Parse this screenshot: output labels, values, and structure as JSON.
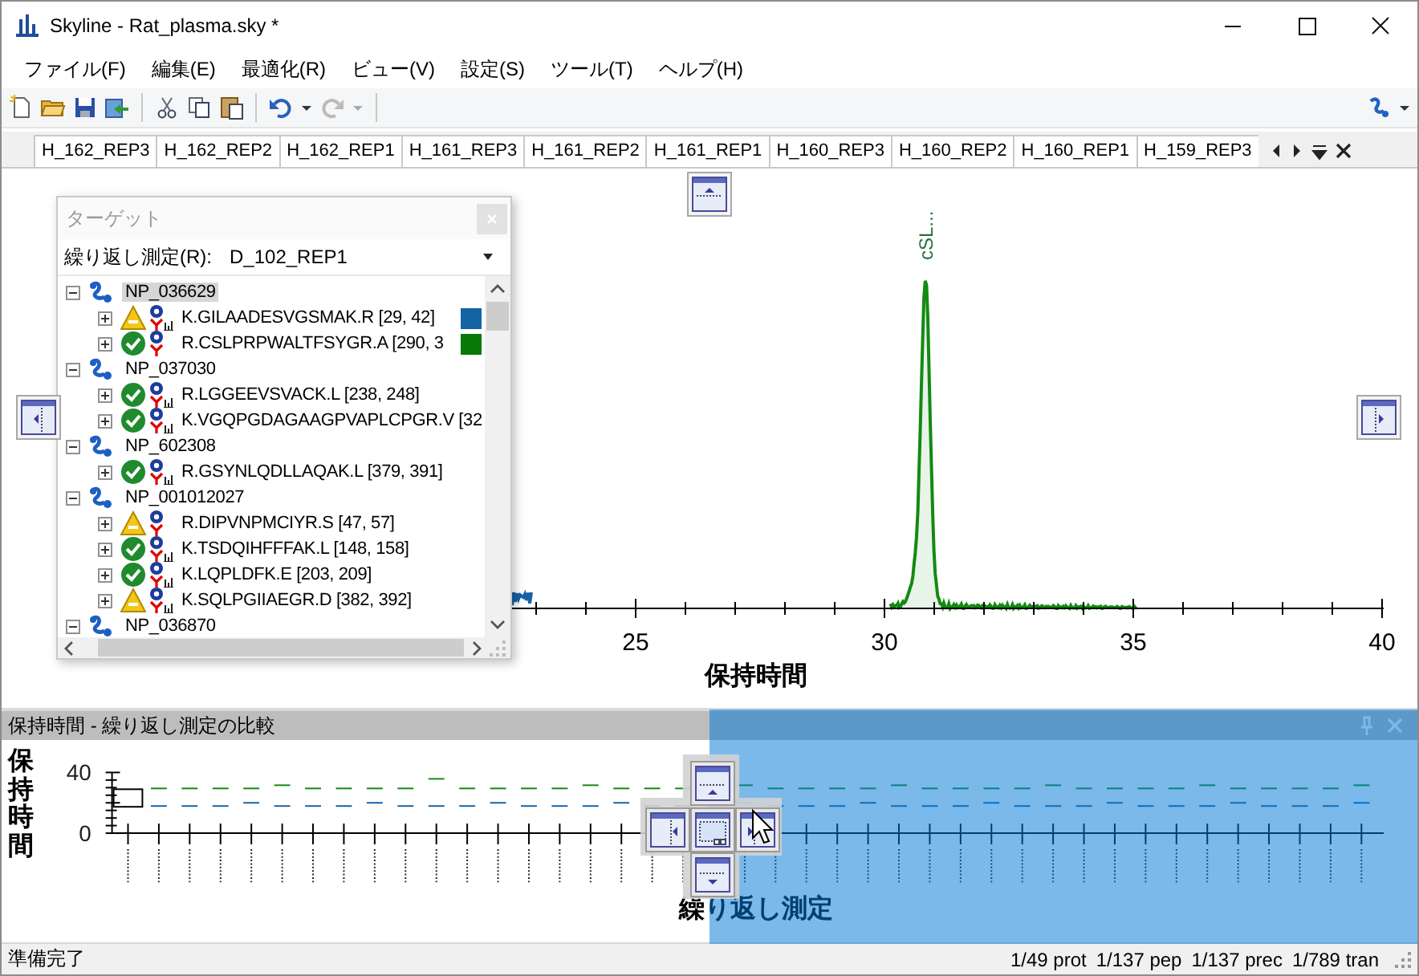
{
  "window": {
    "title": "Skyline - Rat_plasma.sky *"
  },
  "menu": [
    "ファイル(F)",
    "編集(E)",
    "最適化(R)",
    "ビュー(V)",
    "設定(S)",
    "ツール(T)",
    "ヘルプ(H)"
  ],
  "document_tabs": [
    "H_162_REP3",
    "H_162_REP2",
    "H_162_REP1",
    "H_161_REP3",
    "H_161_REP2",
    "H_161_REP1",
    "H_160_REP3",
    "H_160_REP2",
    "H_160_REP1",
    "H_159_REP3"
  ],
  "chromatogram": {
    "peak_label": "cSL...",
    "xticks": [
      "25",
      "30",
      "35",
      "40"
    ],
    "xlabel": "保持時間"
  },
  "targets_window": {
    "title": "ターゲット",
    "replicate_label": "繰り返し測定(R):",
    "replicate_value": "D_102_REP1",
    "proteins": [
      {
        "name": "NP_036629",
        "selected": true,
        "expanded": true,
        "children": [
          {
            "name": "K.GILAADESVGSMAK.R [29, 42]",
            "kind": "warning",
            "results_chart": true,
            "expanded": false,
            "selected": false,
            "color": "#1463a5"
          },
          {
            "name": "R.CSLPRPWALTFSYGR.A [290, 3",
            "kind": "ok",
            "results_chart": false,
            "expanded": false,
            "selected": false,
            "color": "#087a08"
          }
        ]
      },
      {
        "name": "NP_037030",
        "selected": false,
        "expanded": true,
        "children": [
          {
            "name": "R.LGGEEVSVACK.L [238, 248]",
            "kind": "ok",
            "results_chart": true,
            "expanded": false,
            "selected": false
          },
          {
            "name": "K.VGQPGDAGAAGPVAPLCPGR.V [32",
            "kind": "ok",
            "results_chart": true,
            "expanded": false,
            "selected": false
          }
        ]
      },
      {
        "name": "NP_602308",
        "selected": false,
        "expanded": true,
        "children": [
          {
            "name": "R.GSYNLQDLLAQAK.L [379, 391]",
            "kind": "ok",
            "results_chart": true,
            "expanded": false,
            "selected": false
          }
        ]
      },
      {
        "name": "NP_001012027",
        "selected": false,
        "expanded": true,
        "children": [
          {
            "name": "R.DIPVNPMCIYR.S [47, 57]",
            "kind": "warning",
            "results_chart": false,
            "expanded": false,
            "selected": false
          },
          {
            "name": "K.TSDQIHFFFAK.L [148, 158]",
            "kind": "ok",
            "results_chart": true,
            "expanded": false,
            "selected": false
          },
          {
            "name": "K.LQPLDFK.E [203, 209]",
            "kind": "ok",
            "results_chart": true,
            "expanded": false,
            "selected": false
          },
          {
            "name": "K.SQLPGIIAEGR.D [382, 392]",
            "kind": "warning",
            "results_chart": true,
            "expanded": false,
            "selected": false
          }
        ]
      },
      {
        "name": "NP_036870",
        "selected": false,
        "expanded": true
      }
    ]
  },
  "rt_comparison": {
    "title": "保持時間 - 繰り返し測定の比較",
    "ylabel": "保持時間",
    "yticks": [
      "40",
      "0"
    ],
    "xlabel": "繰り返し測定"
  },
  "status_bar": {
    "message": "準備完了",
    "counts": [
      "1/49 prot",
      "1/137 pep",
      "1/137 prec",
      "1/789 tran"
    ]
  }
}
